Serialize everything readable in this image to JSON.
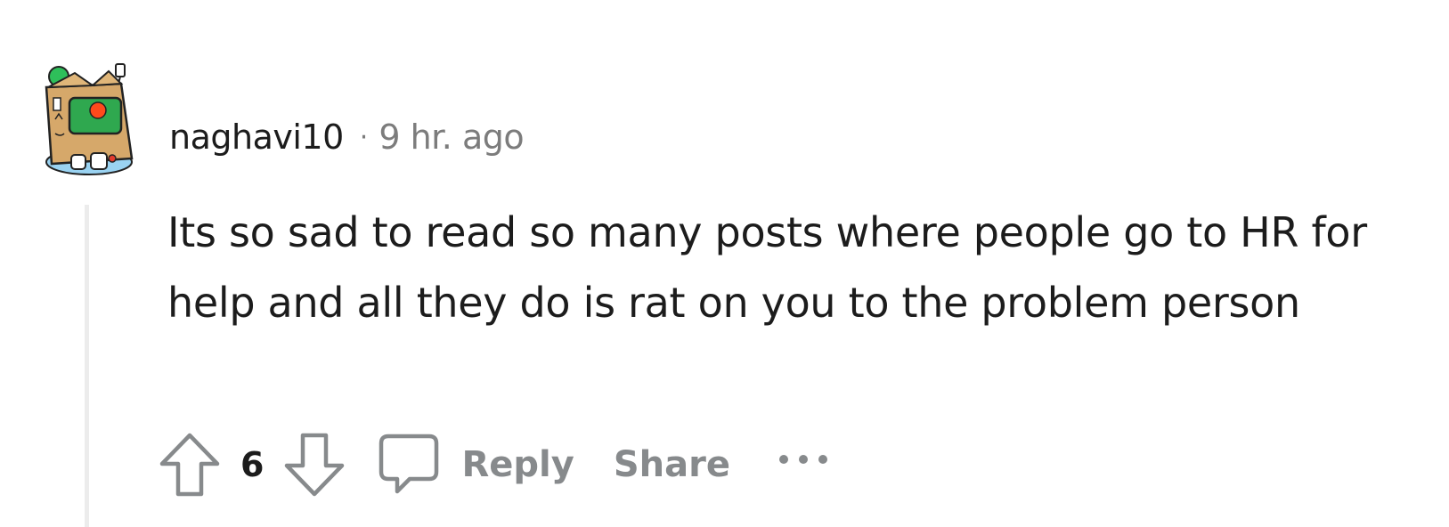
{
  "comment": {
    "username": "naghavi10",
    "separator": "·",
    "timestamp": "9 hr. ago",
    "body": "Its so sad to read so many posts where people go to HR for help and all they do is rat on you to the problem person",
    "score": "6"
  },
  "actions": {
    "reply_label": "Reply",
    "share_label": "Share"
  },
  "icons": {
    "upvote": "upvote-arrow-icon",
    "downvote": "downvote-arrow-icon",
    "reply": "speech-bubble-icon",
    "more": "more-dots-icon"
  },
  "colors": {
    "text": "#1c1c1c",
    "muted": "#7c7c7c",
    "action": "#878a8c",
    "thread_line": "#ececec"
  }
}
